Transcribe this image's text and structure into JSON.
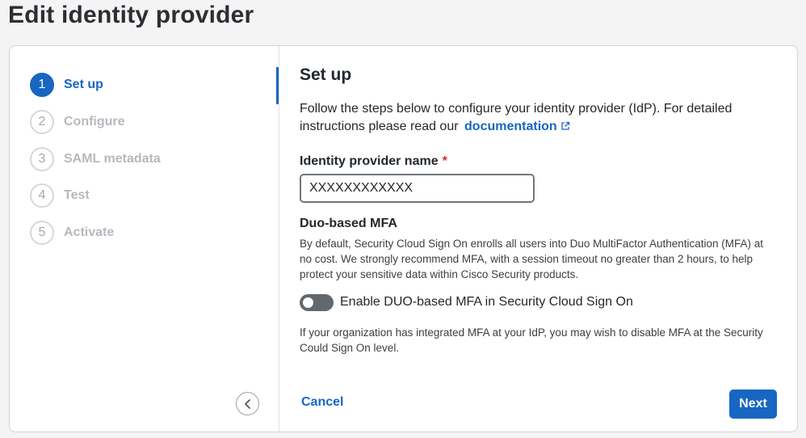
{
  "page": {
    "title": "Edit identity provider"
  },
  "steps": [
    {
      "number": "1",
      "label": "Set up",
      "active": true
    },
    {
      "number": "2",
      "label": "Configure",
      "active": false
    },
    {
      "number": "3",
      "label": "SAML metadata",
      "active": false
    },
    {
      "number": "4",
      "label": "Test",
      "active": false
    },
    {
      "number": "5",
      "label": "Activate",
      "active": false
    }
  ],
  "content": {
    "title": "Set up",
    "intro_text": "Follow the steps below to configure your identity provider (IdP). For detailed instructions please read our",
    "doc_link_label": "documentation",
    "idp_name_label": "Identity provider name",
    "required_mark": "*",
    "idp_name_value": "XXXXXXXXXXXX",
    "mfa_title": "Duo-based MFA",
    "mfa_description": "By default, Security Cloud Sign On enrolls all users into Duo MultiFactor Authentication (MFA) at no cost. We strongly recommend MFA, with a session timeout no greater than 2 hours, to help protect your sensitive data within Cisco Security products.",
    "mfa_toggle_label": "Enable DUO-based MFA in Security Cloud Sign On",
    "mfa_toggle_on": false,
    "mfa_note": "If your organization has integrated MFA at your IdP, you may wish to disable MFA at the Security Could Sign On level."
  },
  "footer": {
    "cancel_label": "Cancel",
    "next_label": "Next"
  },
  "icons": {
    "collapse": "chevron-left-icon",
    "external_link": "external-link-icon"
  },
  "colors": {
    "accent": "#1766c2",
    "required": "#d22d37",
    "toggle_off": "#62686e"
  }
}
